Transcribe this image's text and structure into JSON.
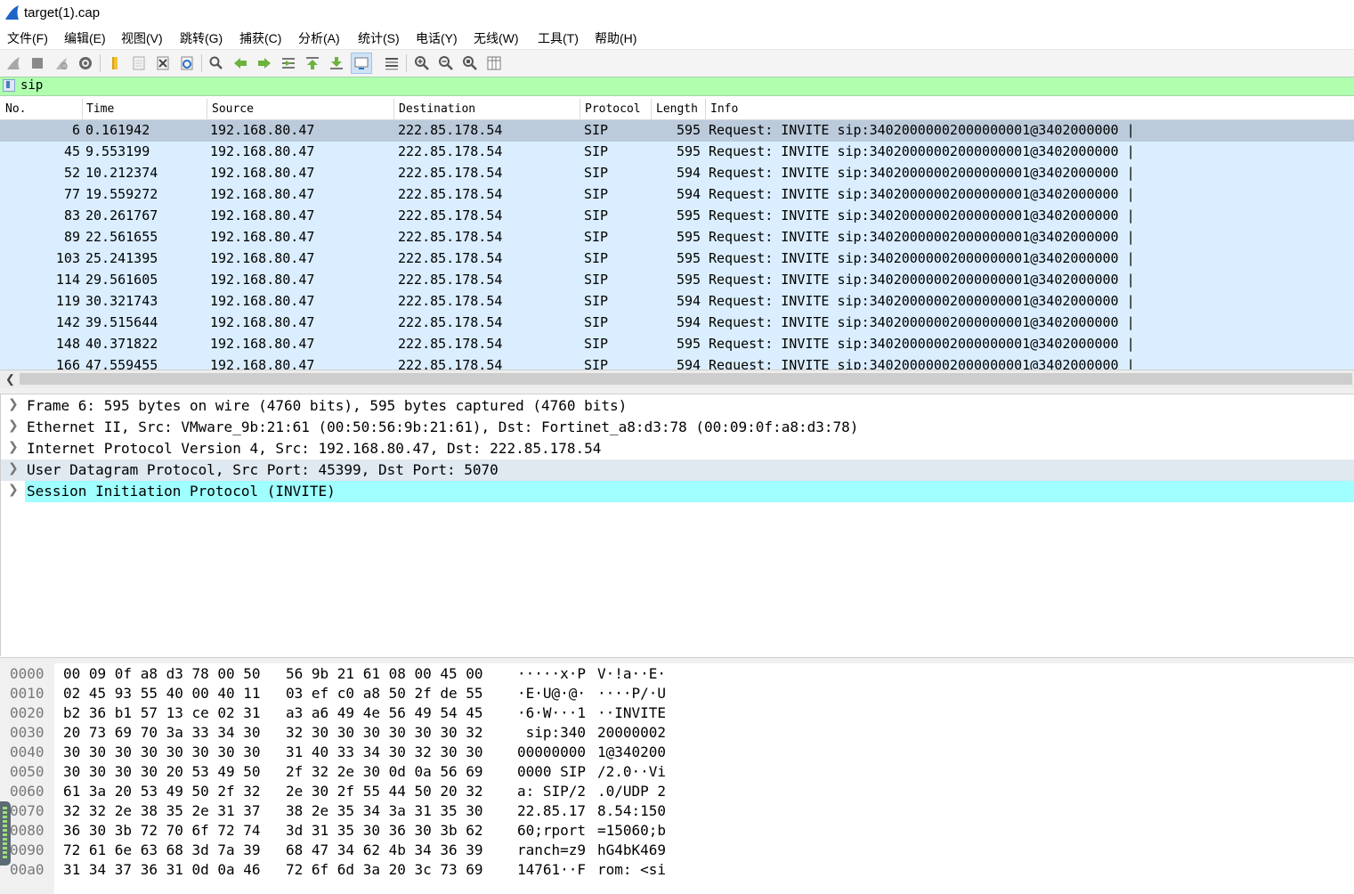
{
  "window": {
    "title": "target(1).cap"
  },
  "menu": [
    "文件(F)",
    "编辑(E)",
    "视图(V)",
    "跳转(G)",
    "捕获(C)",
    "分析(A)",
    "统计(S)",
    "电话(Y)",
    "无线(W)",
    "工具(T)",
    "帮助(H)"
  ],
  "toolbar": {
    "icons": [
      "shark-start-icon",
      "stop-icon",
      "restart-icon",
      "options-gear-icon",
      "open-folder-icon",
      "save-file-icon",
      "close-file-icon",
      "reload-icon",
      "find-icon",
      "go-back-icon",
      "go-forward-icon",
      "go-to-packet-icon",
      "first-packet-icon",
      "last-packet-icon",
      "autoscroll-icon",
      "colorize-icon",
      "zoom-in-icon",
      "zoom-out-icon",
      "zoom-normal-icon",
      "resize-columns-icon"
    ]
  },
  "filter": {
    "value": "sip"
  },
  "columns": [
    "No.",
    "Time",
    "Source",
    "Destination",
    "Protocol",
    "Length",
    "Info"
  ],
  "packets": [
    {
      "no": "6",
      "time": "0.161942",
      "src": "192.168.80.47",
      "dst": "222.85.178.54",
      "proto": "SIP",
      "len": "595",
      "info": "Request: INVITE sip:34020000002000000001@3402000000 |"
    },
    {
      "no": "45",
      "time": "9.553199",
      "src": "192.168.80.47",
      "dst": "222.85.178.54",
      "proto": "SIP",
      "len": "595",
      "info": "Request: INVITE sip:34020000002000000001@3402000000 |"
    },
    {
      "no": "52",
      "time": "10.212374",
      "src": "192.168.80.47",
      "dst": "222.85.178.54",
      "proto": "SIP",
      "len": "594",
      "info": "Request: INVITE sip:34020000002000000001@3402000000 |"
    },
    {
      "no": "77",
      "time": "19.559272",
      "src": "192.168.80.47",
      "dst": "222.85.178.54",
      "proto": "SIP",
      "len": "594",
      "info": "Request: INVITE sip:34020000002000000001@3402000000 |"
    },
    {
      "no": "83",
      "time": "20.261767",
      "src": "192.168.80.47",
      "dst": "222.85.178.54",
      "proto": "SIP",
      "len": "595",
      "info": "Request: INVITE sip:34020000002000000001@3402000000 |"
    },
    {
      "no": "89",
      "time": "22.561655",
      "src": "192.168.80.47",
      "dst": "222.85.178.54",
      "proto": "SIP",
      "len": "595",
      "info": "Request: INVITE sip:34020000002000000001@3402000000 |"
    },
    {
      "no": "103",
      "time": "25.241395",
      "src": "192.168.80.47",
      "dst": "222.85.178.54",
      "proto": "SIP",
      "len": "595",
      "info": "Request: INVITE sip:34020000002000000001@3402000000 |"
    },
    {
      "no": "114",
      "time": "29.561605",
      "src": "192.168.80.47",
      "dst": "222.85.178.54",
      "proto": "SIP",
      "len": "595",
      "info": "Request: INVITE sip:34020000002000000001@3402000000 |"
    },
    {
      "no": "119",
      "time": "30.321743",
      "src": "192.168.80.47",
      "dst": "222.85.178.54",
      "proto": "SIP",
      "len": "594",
      "info": "Request: INVITE sip:34020000002000000001@3402000000 |"
    },
    {
      "no": "142",
      "time": "39.515644",
      "src": "192.168.80.47",
      "dst": "222.85.178.54",
      "proto": "SIP",
      "len": "594",
      "info": "Request: INVITE sip:34020000002000000001@3402000000 |"
    },
    {
      "no": "148",
      "time": "40.371822",
      "src": "192.168.80.47",
      "dst": "222.85.178.54",
      "proto": "SIP",
      "len": "595",
      "info": "Request: INVITE sip:34020000002000000001@3402000000 |"
    },
    {
      "no": "166",
      "time": "47.559455",
      "src": "192.168.80.47",
      "dst": "222.85.178.54",
      "proto": "SIP",
      "len": "594",
      "info": "Request: INVITE sip:34020000002000000001@3402000000 |"
    }
  ],
  "details": [
    "Frame 6: 595 bytes on wire (4760 bits), 595 bytes captured (4760 bits)",
    "Ethernet II, Src: VMware_9b:21:61 (00:50:56:9b:21:61), Dst: Fortinet_a8:d3:78 (00:09:0f:a8:d3:78)",
    "Internet Protocol Version 4, Src: 192.168.80.47, Dst: 222.85.178.54",
    "User Datagram Protocol, Src Port: 45399, Dst Port: 5070",
    "Session Initiation Protocol (INVITE)"
  ],
  "bytes": [
    {
      "off": "0000",
      "h1": "00 09 0f a8 d3 78 00 50",
      "h2": "56 9b 21 61 08 00 45 00",
      "a1": "·····x·P",
      "a2": "V·!a··E·"
    },
    {
      "off": "0010",
      "h1": "02 45 93 55 40 00 40 11",
      "h2": "03 ef c0 a8 50 2f de 55",
      "a1": "·E·U@·@·",
      "a2": "····P/·U"
    },
    {
      "off": "0020",
      "h1": "b2 36 b1 57 13 ce 02 31",
      "h2": "a3 a6 49 4e 56 49 54 45",
      "a1": "·6·W···1",
      "a2": "··INVITE"
    },
    {
      "off": "0030",
      "h1": "20 73 69 70 3a 33 34 30",
      "h2": "32 30 30 30 30 30 30 32",
      "a1": " sip:340",
      "a2": "20000002"
    },
    {
      "off": "0040",
      "h1": "30 30 30 30 30 30 30 30",
      "h2": "31 40 33 34 30 32 30 30",
      "a1": "00000000",
      "a2": "1@340200"
    },
    {
      "off": "0050",
      "h1": "30 30 30 30 20 53 49 50",
      "h2": "2f 32 2e 30 0d 0a 56 69",
      "a1": "0000 SIP",
      "a2": "/2.0··Vi"
    },
    {
      "off": "0060",
      "h1": "61 3a 20 53 49 50 2f 32",
      "h2": "2e 30 2f 55 44 50 20 32",
      "a1": "a: SIP/2",
      "a2": ".0/UDP 2"
    },
    {
      "off": "0070",
      "h1": "32 32 2e 38 35 2e 31 37",
      "h2": "38 2e 35 34 3a 31 35 30",
      "a1": "22.85.17",
      "a2": "8.54:150"
    },
    {
      "off": "0080",
      "h1": "36 30 3b 72 70 6f 72 74",
      "h2": "3d 31 35 30 36 30 3b 62",
      "a1": "60;rport",
      "a2": "=15060;b"
    },
    {
      "off": "0090",
      "h1": "72 61 6e 63 68 3d 7a 39",
      "h2": "68 47 34 62 4b 34 36 39",
      "a1": "ranch=z9",
      "a2": "hG4bK469"
    },
    {
      "off": "00a0",
      "h1": "31 34 37 36 31 0d 0a 46",
      "h2": "72 6f 6d 3a 20 3c 73 69",
      "a1": "14761··F",
      "a2": "rom: <si"
    }
  ]
}
